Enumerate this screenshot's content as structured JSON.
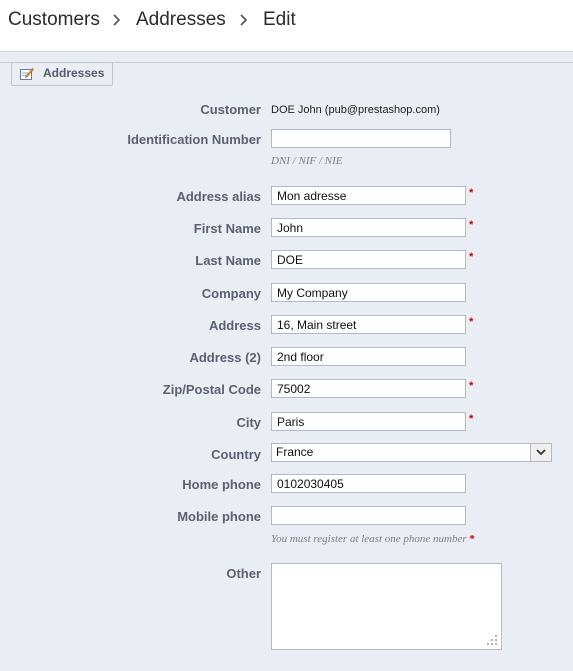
{
  "breadcrumb": {
    "items": [
      "Customers",
      "Addresses",
      "Edit"
    ]
  },
  "panel": {
    "legend": "Addresses"
  },
  "form": {
    "customer": {
      "label": "Customer",
      "value": "DOE John (pub@prestashop.com)"
    },
    "identification": {
      "label": "Identification Number",
      "value": "",
      "hint": "DNI / NIF / NIE"
    },
    "alias": {
      "label": "Address alias",
      "value": "Mon adresse"
    },
    "firstname": {
      "label": "First Name",
      "value": "John"
    },
    "lastname": {
      "label": "Last Name",
      "value": "DOE"
    },
    "company": {
      "label": "Company",
      "value": "My Company"
    },
    "address1": {
      "label": "Address",
      "value": "16, Main street"
    },
    "address2": {
      "label": "Address (2)",
      "value": "2nd floor"
    },
    "postcode": {
      "label": "Zip/Postal Code",
      "value": "75002"
    },
    "city": {
      "label": "City",
      "value": "Paris"
    },
    "country": {
      "label": "Country",
      "value": "France"
    },
    "phone": {
      "label": "Home phone",
      "value": "0102030405"
    },
    "mobile": {
      "label": "Mobile phone",
      "value": "",
      "hint": "You must register at least one phone number"
    },
    "other": {
      "label": "Other",
      "value": ""
    },
    "required_mark": "*"
  },
  "colors": {
    "background": "#ebedf4",
    "required": "#cc0000",
    "label": "#5c6170"
  }
}
